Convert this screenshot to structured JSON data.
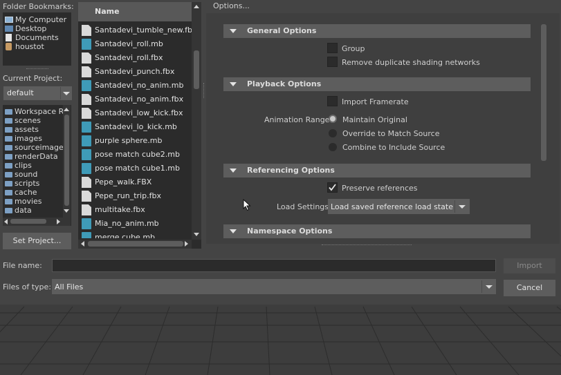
{
  "left_panel": {
    "bookmarks_label": "Folder Bookmarks:",
    "bookmarks": [
      {
        "label": "My Computer",
        "icon": "computer-icon"
      },
      {
        "label": "Desktop",
        "icon": "desktop-icon"
      },
      {
        "label": "Documents",
        "icon": "documents-icon"
      },
      {
        "label": "houstot",
        "icon": "user-folder-icon"
      }
    ],
    "current_project_label": "Current Project:",
    "current_project_value": "default",
    "project_folders": [
      "Workspace Re",
      "scenes",
      "assets",
      "images",
      "sourceimages",
      "renderData",
      "clips",
      "sound",
      "scripts",
      "cache",
      "movies",
      "data"
    ],
    "set_project_button": "Set Project..."
  },
  "file_list": {
    "column_header": "Name",
    "files": [
      {
        "name": "Santadevi_tumble_new.fbx",
        "type": "fbx"
      },
      {
        "name": "Santadevi_roll.mb",
        "type": "mb"
      },
      {
        "name": "Santadevi_roll.fbx",
        "type": "fbx"
      },
      {
        "name": "Santadevi_punch.fbx",
        "type": "fbx"
      },
      {
        "name": "Santadevi_no_anim.mb",
        "type": "mb"
      },
      {
        "name": "Santadevi_no_anim.fbx",
        "type": "fbx"
      },
      {
        "name": "Santadevi_low_kick.fbx",
        "type": "fbx"
      },
      {
        "name": "Santadevi_lo_kick.mb",
        "type": "mb"
      },
      {
        "name": "purple sphere.mb",
        "type": "mb"
      },
      {
        "name": "pose match cube2.mb",
        "type": "mb"
      },
      {
        "name": "pose match cube1.mb",
        "type": "mb"
      },
      {
        "name": "Pepe_walk.FBX",
        "type": "fbx"
      },
      {
        "name": "Pepe_run_trip.fbx",
        "type": "fbx"
      },
      {
        "name": "multitake.fbx",
        "type": "fbx"
      },
      {
        "name": "Mia_no_anim.mb",
        "type": "mb"
      },
      {
        "name": "merge cube.mb",
        "type": "mb"
      }
    ]
  },
  "options": {
    "title": "Options...",
    "sections": {
      "general": "General Options",
      "playback": "Playback Options",
      "referencing": "Referencing Options",
      "namespace": "Namespace Options"
    },
    "group_label": "Group",
    "remove_duplicate_label": "Remove duplicate shading networks",
    "import_framerate_label": "Import Framerate",
    "animation_range_label": "Animation Range",
    "animation_range_options": [
      "Maintain Original",
      "Override to Match Source",
      "Combine to Include Source"
    ],
    "preserve_references_label": "Preserve references",
    "load_settings_label": "Load Settings",
    "load_settings_value": "Load saved reference load state"
  },
  "bottom": {
    "file_name_label": "File name:",
    "file_name_value": "",
    "files_of_type_label": "Files of type:",
    "files_of_type_value": "All Files",
    "import_button": "Import",
    "cancel_button": "Cancel"
  },
  "colors": {
    "accent_line": "#86a27e",
    "file_icon_mb": "#3f9bb8",
    "file_icon_fbx": "#d9d9d9"
  }
}
